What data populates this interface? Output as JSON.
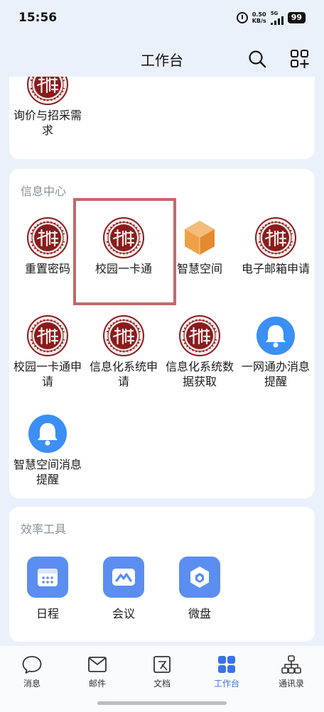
{
  "status_bar": {
    "time": "15:56",
    "net_speed_value": "0.50",
    "net_speed_unit": "KB/s",
    "signal_label": "5G",
    "battery": "99",
    "icons": [
      "alarm-icon",
      "signal-icon",
      "battery-icon"
    ]
  },
  "header": {
    "title": "工作台",
    "icons": [
      "search-icon",
      "add-app-icon"
    ]
  },
  "top_card": {
    "apps": [
      {
        "label": "询价与招采需求",
        "icon": "school-seal-icon"
      }
    ]
  },
  "info_center": {
    "title": "信息中心",
    "apps": [
      {
        "label": "重置密码",
        "icon": "school-seal-icon"
      },
      {
        "label": "校园一卡通",
        "icon": "school-seal-icon"
      },
      {
        "label": "智慧空间",
        "icon": "hexagon-cube-icon"
      },
      {
        "label": "电子邮箱申请",
        "icon": "school-seal-icon"
      },
      {
        "label": "校园一卡通申请",
        "icon": "school-seal-icon"
      },
      {
        "label": "信息化系统申请",
        "icon": "school-seal-icon"
      },
      {
        "label": "信息化系统数据获取",
        "icon": "school-seal-icon"
      },
      {
        "label": "一网通办消息提醒",
        "icon": "bell-icon"
      },
      {
        "label": "智慧空间消息提醒",
        "icon": "bell-icon"
      }
    ]
  },
  "efficiency_tools": {
    "title": "效率工具",
    "apps": [
      {
        "label": "日程",
        "icon": "calendar-icon"
      },
      {
        "label": "会议",
        "icon": "meeting-icon"
      },
      {
        "label": "微盘",
        "icon": "cloud-drive-icon"
      }
    ]
  },
  "tabbar": {
    "tabs": [
      {
        "label": "消息",
        "icon": "chat-bubble-icon"
      },
      {
        "label": "邮件",
        "icon": "mail-icon"
      },
      {
        "label": "文档",
        "icon": "document-icon"
      },
      {
        "label": "工作台",
        "icon": "grid-icon",
        "active": true
      },
      {
        "label": "通讯录",
        "icon": "org-chart-icon"
      }
    ]
  },
  "colors": {
    "background": "#eaf1fa",
    "accent": "#3a72e8",
    "highlight": "#c06a6a",
    "seal_red": "#8b1c1c",
    "bell_blue": "#3b8ff5",
    "hexagon_orange": "#f0a04a"
  }
}
